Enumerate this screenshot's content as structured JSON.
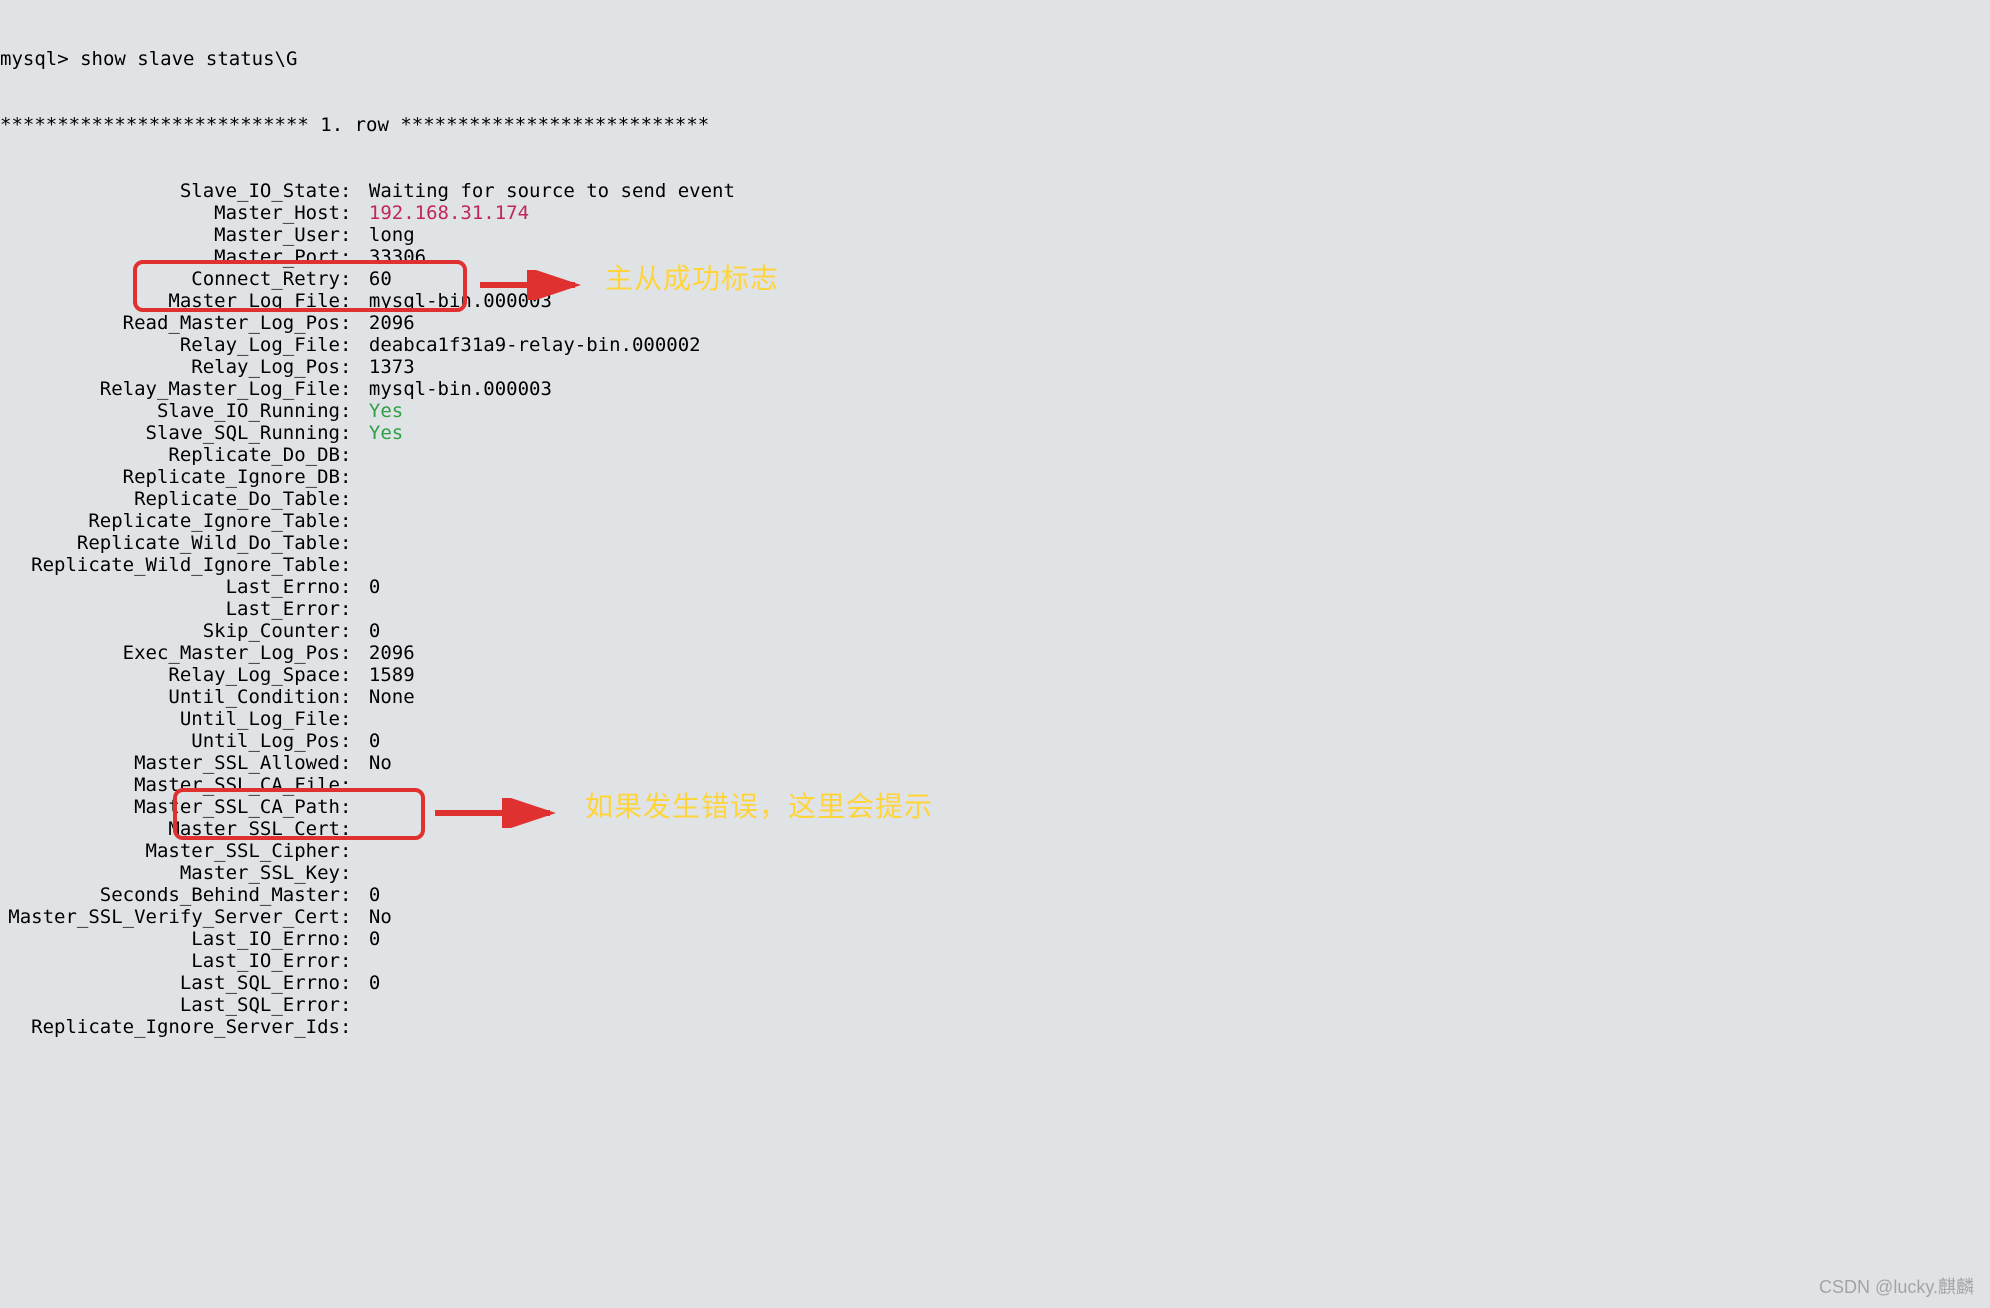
{
  "cmd_prompt": "mysql> ",
  "cmd_text": "show slave status\\G",
  "row_header": "*************************** 1. row ***************************",
  "rows": [
    {
      "label": "Slave_IO_State",
      "value": "Waiting for source to send event"
    },
    {
      "label": "Master_Host",
      "value": "192.168.31.174",
      "cls": "pink"
    },
    {
      "label": "Master_User",
      "value": "long"
    },
    {
      "label": "Master_Port",
      "value": "33306"
    },
    {
      "label": "Connect_Retry",
      "value": "60"
    },
    {
      "label": "Master_Log_File",
      "value": "mysql-bin.000003"
    },
    {
      "label": "Read_Master_Log_Pos",
      "value": "2096"
    },
    {
      "label": "Relay_Log_File",
      "value": "deabca1f31a9-relay-bin.000002"
    },
    {
      "label": "Relay_Log_Pos",
      "value": "1373"
    },
    {
      "label": "Relay_Master_Log_File",
      "value": "mysql-bin.000003"
    },
    {
      "label": "Slave_IO_Running",
      "value": "Yes",
      "cls": "green"
    },
    {
      "label": "Slave_SQL_Running",
      "value": "Yes",
      "cls": "green"
    },
    {
      "label": "Replicate_Do_DB",
      "value": ""
    },
    {
      "label": "Replicate_Ignore_DB",
      "value": ""
    },
    {
      "label": "Replicate_Do_Table",
      "value": ""
    },
    {
      "label": "Replicate_Ignore_Table",
      "value": ""
    },
    {
      "label": "Replicate_Wild_Do_Table",
      "value": ""
    },
    {
      "label": "Replicate_Wild_Ignore_Table",
      "value": ""
    },
    {
      "label": "Last_Errno",
      "value": "0"
    },
    {
      "label": "Last_Error",
      "value": ""
    },
    {
      "label": "Skip_Counter",
      "value": "0"
    },
    {
      "label": "Exec_Master_Log_Pos",
      "value": "2096"
    },
    {
      "label": "Relay_Log_Space",
      "value": "1589"
    },
    {
      "label": "Until_Condition",
      "value": "None"
    },
    {
      "label": "Until_Log_File",
      "value": ""
    },
    {
      "label": "Until_Log_Pos",
      "value": "0"
    },
    {
      "label": "Master_SSL_Allowed",
      "value": "No"
    },
    {
      "label": "Master_SSL_CA_File",
      "value": ""
    },
    {
      "label": "Master_SSL_CA_Path",
      "value": ""
    },
    {
      "label": "Master_SSL_Cert",
      "value": ""
    },
    {
      "label": "Master_SSL_Cipher",
      "value": ""
    },
    {
      "label": "Master_SSL_Key",
      "value": ""
    },
    {
      "label": "Seconds_Behind_Master",
      "value": "0"
    },
    {
      "label": "Master_SSL_Verify_Server_Cert",
      "value": "No"
    },
    {
      "label": "Last_IO_Errno",
      "value": "0"
    },
    {
      "label": "Last_IO_Error",
      "value": ""
    },
    {
      "label": "Last_SQL_Errno",
      "value": "0"
    },
    {
      "label": "Last_SQL_Error",
      "value": ""
    },
    {
      "label": "Replicate_Ignore_Server_Ids",
      "value": ""
    }
  ],
  "annotation1": "主从成功标志",
  "annotation2": "如果发生错误，这里会提示",
  "watermark": "CSDN @lucky.麒麟"
}
